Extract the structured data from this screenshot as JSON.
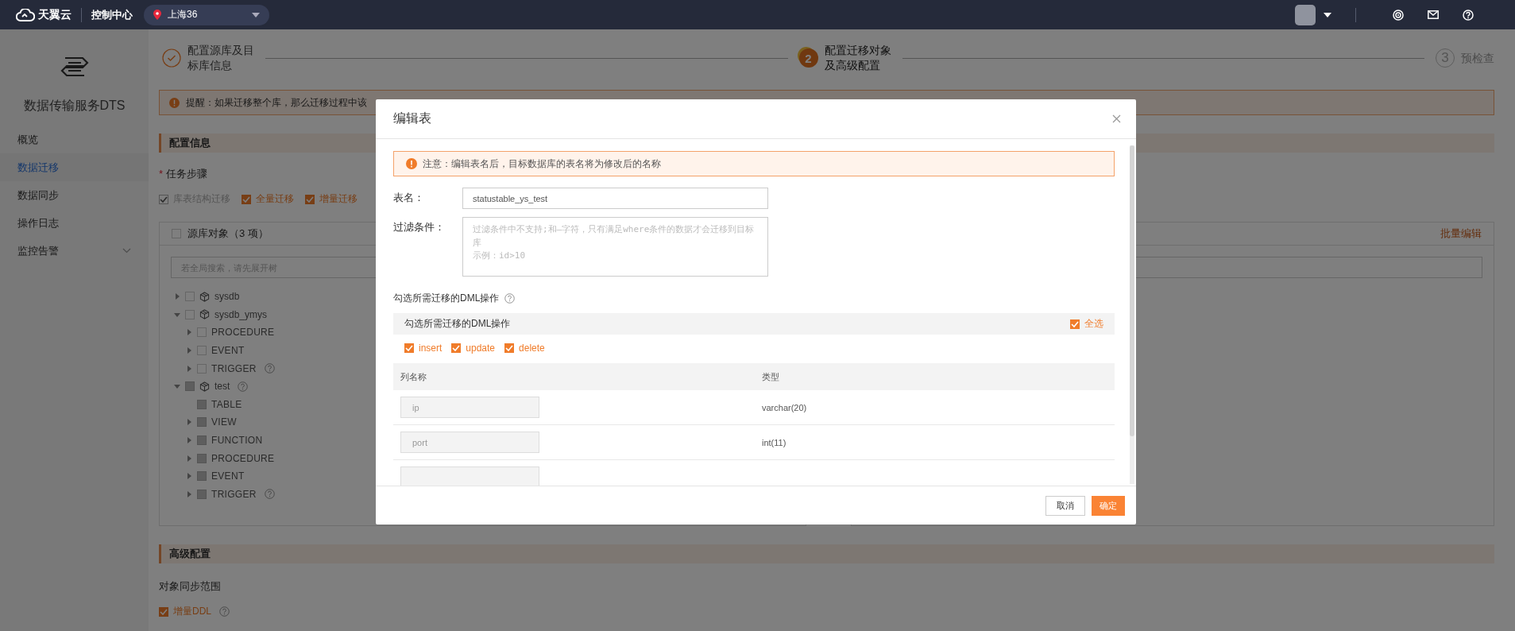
{
  "topbar": {
    "brand": "天翼云",
    "console": "控制中心",
    "region": "上海36"
  },
  "sidebar": {
    "title": "数据传输服务DTS",
    "items": [
      {
        "label": "概览",
        "selected": false,
        "expandable": false
      },
      {
        "label": "数据迁移",
        "selected": true,
        "expandable": false
      },
      {
        "label": "数据同步",
        "selected": false,
        "expandable": false
      },
      {
        "label": "操作日志",
        "selected": false,
        "expandable": false
      },
      {
        "label": "监控告警",
        "selected": false,
        "expandable": true
      }
    ]
  },
  "steps": [
    {
      "label": "配置源库及目标库信息",
      "done": true,
      "active": false
    },
    {
      "number": "2",
      "label": "配置迁移对象及高级配置",
      "done": false,
      "active": true
    },
    {
      "number": "3",
      "label": "预检查",
      "done": false,
      "active": false
    }
  ],
  "notice": {
    "text": "提醒：如果迁移整个库，那么迁移过程中该"
  },
  "config_section": {
    "title": "配置信息",
    "task_steps": {
      "required_mark": "*",
      "label": "任务步骤",
      "options": [
        {
          "label": "库表结构迁移",
          "checked": true,
          "disabled": true
        },
        {
          "label": "全量迁移",
          "checked": true,
          "disabled": false
        },
        {
          "label": "增量迁移",
          "checked": true,
          "disabled": false
        }
      ]
    }
  },
  "source_panel": {
    "title": "源库对象（3 项）",
    "checked": false,
    "search_placeholder": "若全局搜索，请先展开树",
    "tree": [
      {
        "label": "sysdb",
        "kind": "database",
        "expanded": false,
        "checked": false,
        "disabled": false,
        "help": false
      },
      {
        "label": "sysdb_ymys",
        "kind": "database",
        "expanded": true,
        "checked": false,
        "disabled": false,
        "help": false,
        "children": [
          {
            "label": "PROCEDURE",
            "kind": "group",
            "expanded": false,
            "checked": false,
            "disabled": false,
            "help": false
          },
          {
            "label": "EVENT",
            "kind": "group",
            "expanded": false,
            "checked": false,
            "disabled": false,
            "help": false
          },
          {
            "label": "TRIGGER",
            "kind": "group",
            "expanded": false,
            "checked": false,
            "disabled": false,
            "help": true
          }
        ]
      },
      {
        "label": "test",
        "kind": "database",
        "expanded": true,
        "checked": false,
        "disabled": true,
        "help": true,
        "children": [
          {
            "label": "TABLE",
            "kind": "group",
            "checked": false,
            "disabled": true,
            "help": false
          },
          {
            "label": "VIEW",
            "kind": "group",
            "expanded": false,
            "checked": false,
            "disabled": true,
            "help": false
          },
          {
            "label": "FUNCTION",
            "kind": "group",
            "expanded": false,
            "checked": false,
            "disabled": true,
            "help": false
          },
          {
            "label": "PROCEDURE",
            "kind": "group",
            "expanded": false,
            "checked": false,
            "disabled": true,
            "help": false
          },
          {
            "label": "EVENT",
            "kind": "group",
            "expanded": false,
            "checked": false,
            "disabled": true,
            "help": false
          },
          {
            "label": "TRIGGER",
            "kind": "group",
            "expanded": false,
            "checked": false,
            "disabled": true,
            "help": true
          }
        ]
      }
    ]
  },
  "target_panel": {
    "action": "批量编辑"
  },
  "advanced_section": {
    "title": "高级配置",
    "scope_label": "对象同步范围",
    "options": [
      {
        "label": "增量DDL",
        "checked": true,
        "help": true
      }
    ]
  },
  "dialog": {
    "title": "编辑表",
    "warning": "注意：编辑表名后，目标数据库的表名将为修改后的名称",
    "table_name": {
      "label": "表名：",
      "value": "statustable_ys_test"
    },
    "filter": {
      "label": "过滤条件：",
      "placeholder": "过滤条件中不支持;和—字符，只有满足where条件的数据才会迁移到目标库",
      "example": "示例：id>10"
    },
    "dml_heading": "勾选所需迁移的DML操作",
    "dml_bar_title": "勾选所需迁移的DML操作",
    "select_all": {
      "label": "全选",
      "checked": true
    },
    "dml_ops": [
      {
        "label": "insert",
        "checked": true
      },
      {
        "label": "update",
        "checked": true
      },
      {
        "label": "delete",
        "checked": true
      }
    ],
    "columns": [
      "列名称",
      "类型"
    ],
    "rows": [
      {
        "name": "ip",
        "type": "varchar(20)",
        "partial": false
      },
      {
        "name": "port",
        "type": "int(11)",
        "partial": false
      },
      {
        "partial": true
      }
    ],
    "buttons": [
      {
        "label": "取消",
        "kind": "secondary"
      },
      {
        "label": "确定",
        "kind": "primary"
      }
    ]
  }
}
